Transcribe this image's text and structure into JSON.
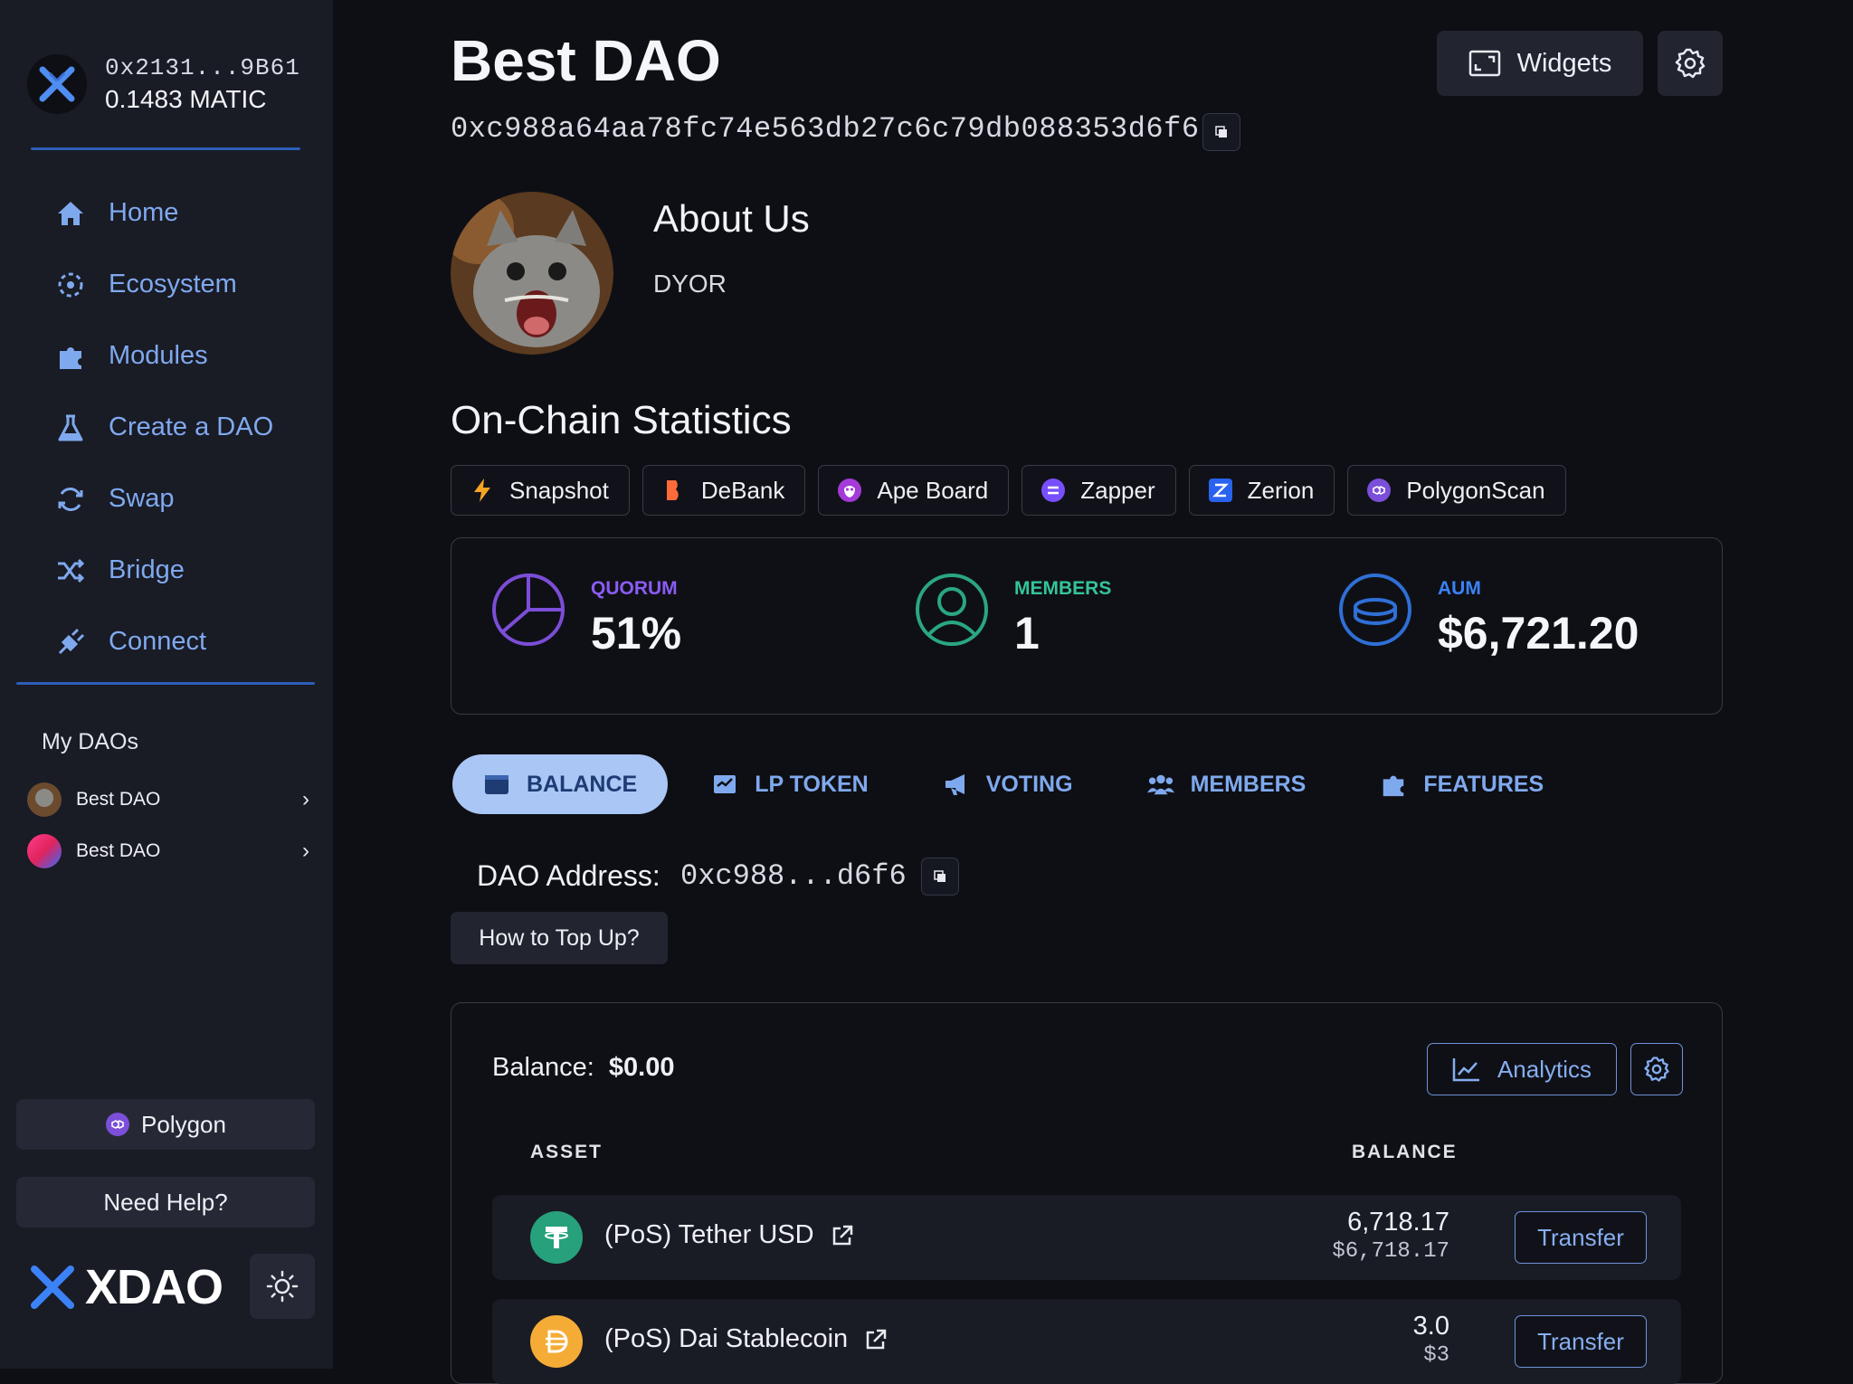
{
  "account": {
    "address": "0x2131...9B61",
    "balance": "0.1483 MATIC"
  },
  "nav": [
    {
      "label": "Home",
      "icon": "home-icon"
    },
    {
      "label": "Ecosystem",
      "icon": "ecosystem-icon"
    },
    {
      "label": "Modules",
      "icon": "puzzle-icon"
    },
    {
      "label": "Create a DAO",
      "icon": "flask-icon"
    },
    {
      "label": "Swap",
      "icon": "swap-icon"
    },
    {
      "label": "Bridge",
      "icon": "shuffle-icon"
    },
    {
      "label": "Connect",
      "icon": "plug-icon"
    }
  ],
  "my_daos": {
    "title": "My DAOs",
    "items": [
      {
        "name": "Best DAO"
      },
      {
        "name": "Best DAO"
      }
    ]
  },
  "network_button": "Polygon",
  "help_button": "Need Help?",
  "brand": "XDAO",
  "dao": {
    "title": "Best DAO",
    "address": "0xc988a64aa78fc74e563db27c6c79db088353d6f6",
    "widgets_label": "Widgets",
    "about_title": "About Us",
    "about_text": "DYOR"
  },
  "stats": {
    "title": "On-Chain Statistics",
    "links": [
      "Snapshot",
      "DeBank",
      "Ape Board",
      "Zapper",
      "Zerion",
      "PolygonScan"
    ],
    "quorum": {
      "label": "QUORUM",
      "value": "51%"
    },
    "members": {
      "label": "MEMBERS",
      "value": "1"
    },
    "aum": {
      "label": "AUM",
      "value": "$6,721.20"
    }
  },
  "tabs": [
    "BALANCE",
    "LP TOKEN",
    "VOTING",
    "MEMBERS",
    "FEATURES"
  ],
  "active_tab": "BALANCE",
  "balance_section": {
    "dao_address_label": "DAO Address:",
    "dao_address_short": "0xc988...d6f6",
    "topup_label": "How to Top Up?",
    "balance_label": "Balance:",
    "balance_value": "$0.00",
    "analytics_label": "Analytics",
    "col_asset": "ASSET",
    "col_balance": "BALANCE",
    "assets": [
      {
        "name": "(PoS) Tether USD",
        "amount": "6,718.17",
        "usd": "$6,718.17",
        "action": "Transfer"
      },
      {
        "name": "(PoS) Dai Stablecoin",
        "amount": "3.0",
        "usd": "$3",
        "action": "Transfer"
      }
    ]
  },
  "colors": {
    "background": "#0e0f14",
    "sidebar": "#191b25",
    "accent": "#7fa9ee",
    "quorum": "#8b5cf6",
    "members": "#34c49a",
    "aum": "#3b82f6"
  }
}
